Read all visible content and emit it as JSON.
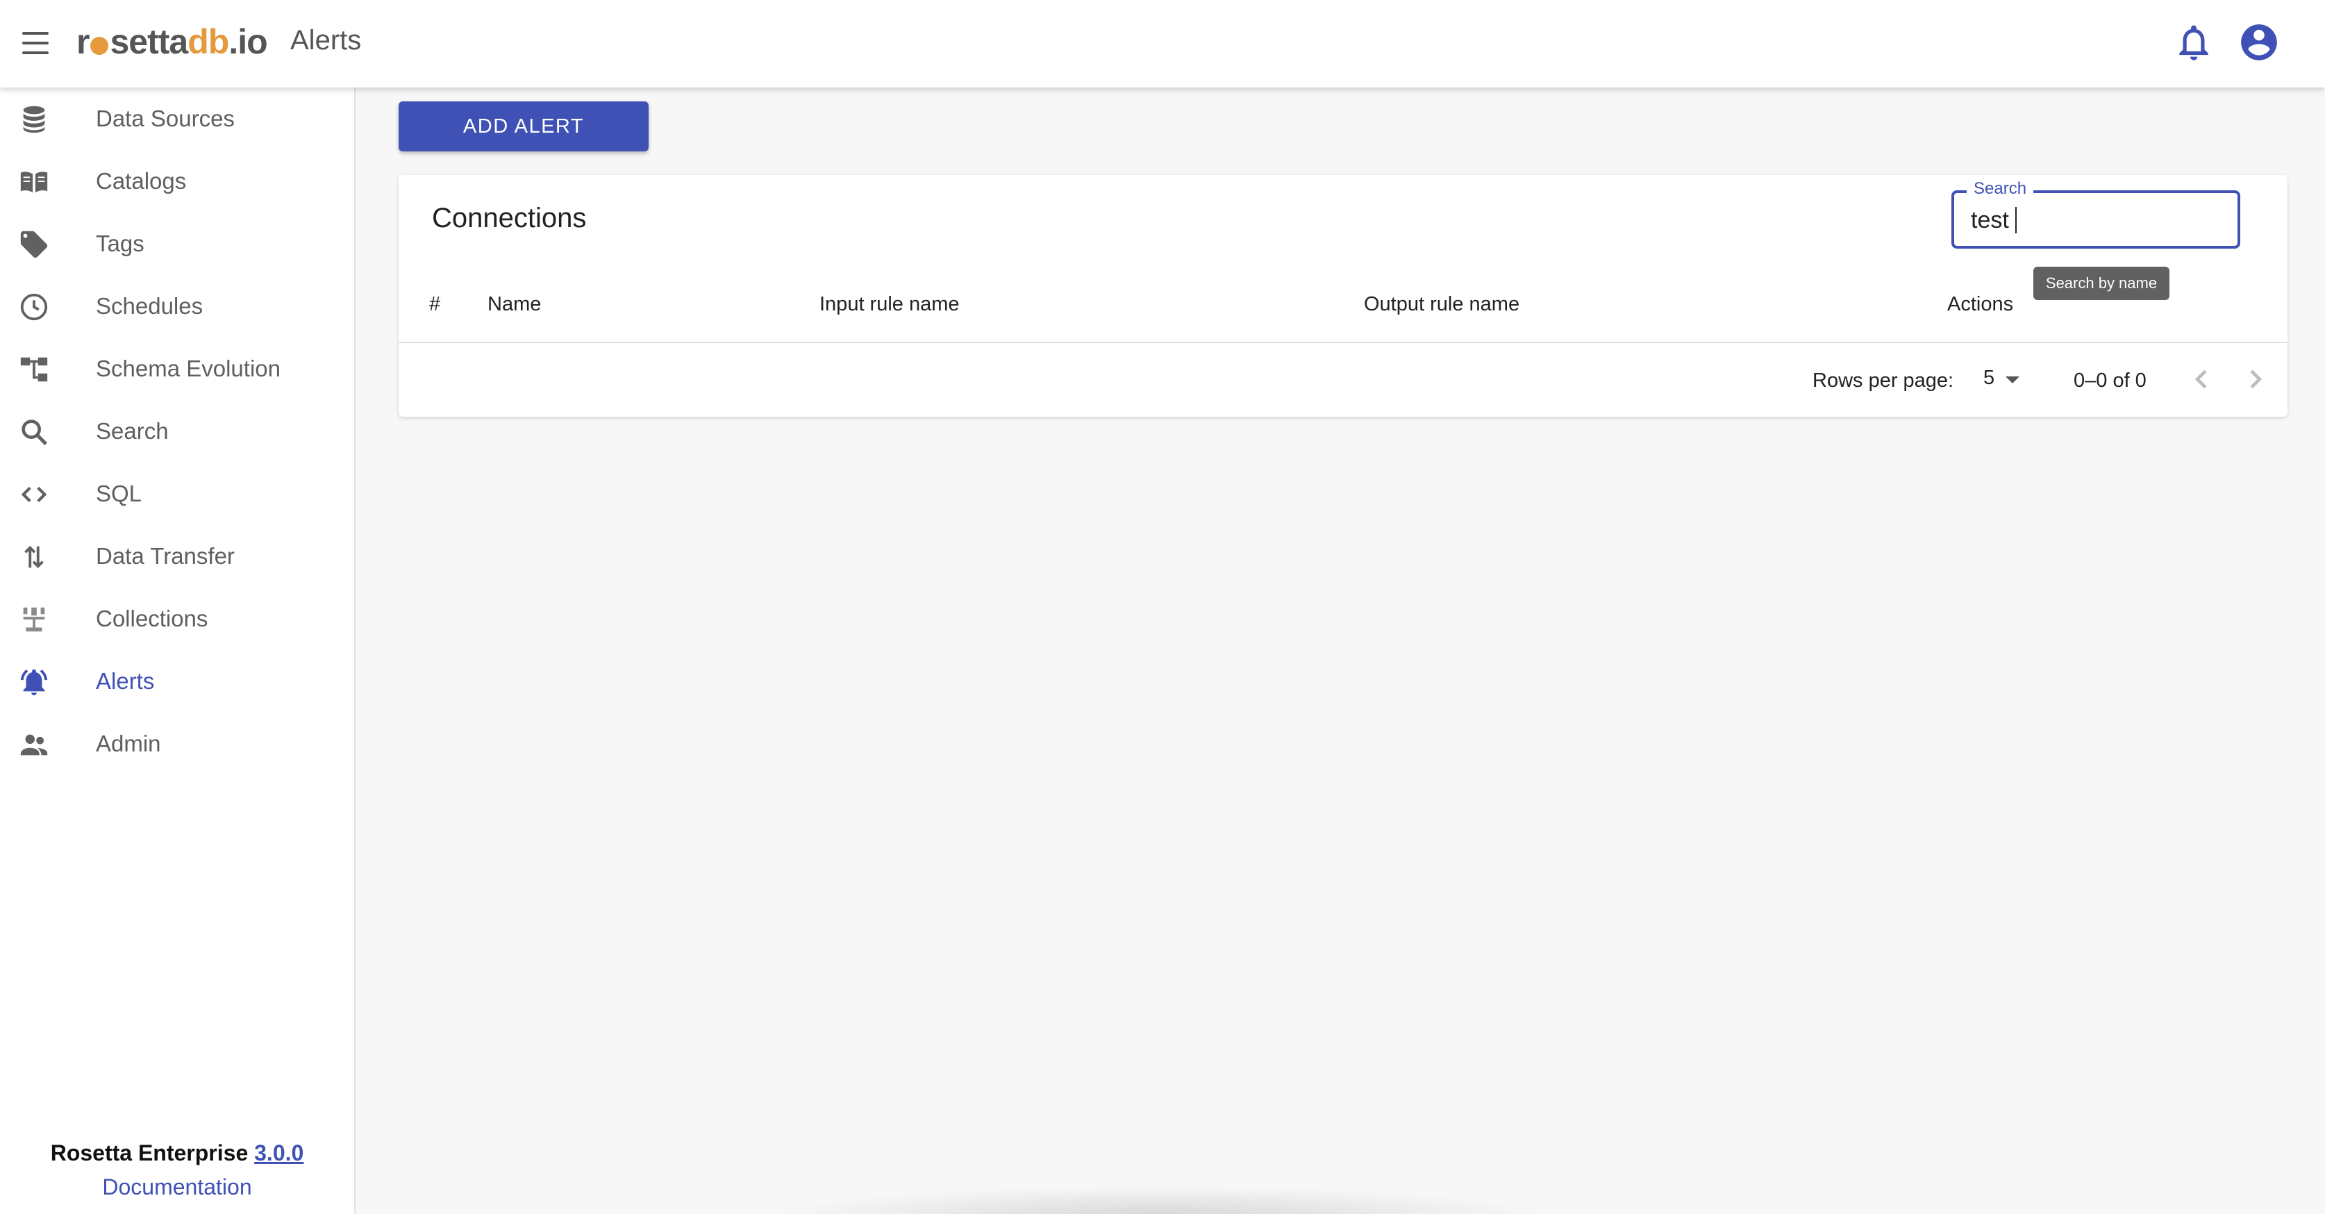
{
  "app": {
    "logo_prefix": "r",
    "logo_mid": "setta",
    "logo_accent": "db",
    "logo_suffix": ".io",
    "page_title": "Alerts"
  },
  "header": {
    "menu_icon": "hamburger-menu-icon",
    "notifications_icon": "bell-icon",
    "account_icon": "account-circle-icon"
  },
  "sidebar": {
    "items": [
      {
        "label": "Data Sources",
        "icon": "database-icon"
      },
      {
        "label": "Catalogs",
        "icon": "book-icon"
      },
      {
        "label": "Tags",
        "icon": "tag-icon"
      },
      {
        "label": "Schedules",
        "icon": "clock-icon"
      },
      {
        "label": "Schema Evolution",
        "icon": "schema-tree-icon"
      },
      {
        "label": "Search",
        "icon": "search-icon"
      },
      {
        "label": "SQL",
        "icon": "code-icon"
      },
      {
        "label": "Data Transfer",
        "icon": "swap-vertical-icon"
      },
      {
        "label": "Collections",
        "icon": "collections-icon"
      },
      {
        "label": "Alerts",
        "icon": "alarm-bell-icon",
        "active": true
      },
      {
        "label": "Admin",
        "icon": "people-icon"
      }
    ],
    "footer": {
      "product": "Rosetta Enterprise",
      "version": "3.0.0",
      "documentation": "Documentation"
    }
  },
  "main": {
    "add_alert_label": "ADD ALERT",
    "card": {
      "title": "Connections",
      "search": {
        "legend": "Search",
        "value": "test",
        "tooltip": "Search by name"
      },
      "columns": [
        "#",
        "Name",
        "Input rule name",
        "Output rule name",
        "Actions"
      ],
      "rows": [],
      "pagination": {
        "rows_per_page_label": "Rows per page:",
        "rows_per_page_value": "5",
        "range": "0–0 of 0"
      }
    }
  },
  "colors": {
    "primary": "#3f51b5",
    "logo_accent": "#e59a3c",
    "background": "#f7f7f7"
  }
}
